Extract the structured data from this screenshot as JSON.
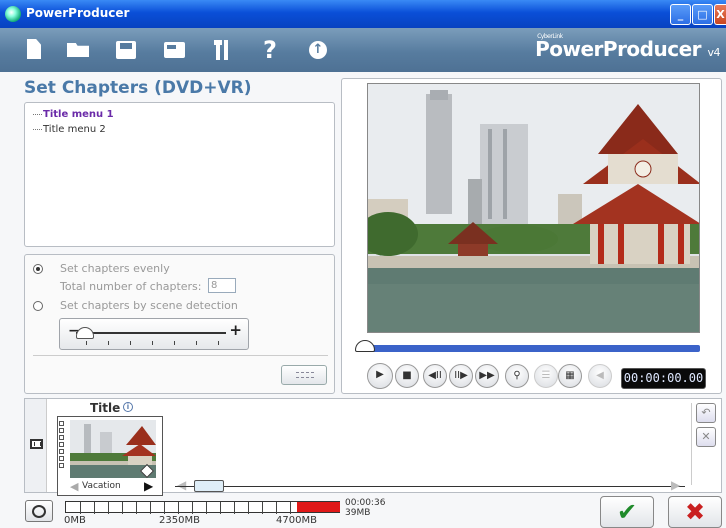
{
  "window": {
    "title": "PowerProducer",
    "minimize": "_",
    "maximize": "□",
    "close": "X"
  },
  "toolbar": {
    "icons": [
      "new-project-icon",
      "open-icon",
      "save-icon",
      "burn-icon",
      "tools-icon",
      "help-icon",
      "update-icon"
    ],
    "help_glyph": "?",
    "update_glyph": "↑",
    "brand_small": "CyberLink",
    "brand": "PowerProducer",
    "version": "v4"
  },
  "page": {
    "heading": "Set Chapters (DVD+VR)"
  },
  "menu_list": {
    "items": [
      "Title menu 1",
      "Title menu 2"
    ],
    "selected_index": 0
  },
  "chapter_options": {
    "evenly_label": "Set chapters evenly",
    "total_label": "Total number of chapters:",
    "total_value": "8",
    "scene_label": "Set chapters by scene detection",
    "selected": "evenly",
    "minus": "−",
    "plus": "+",
    "sensitivity_level": 0
  },
  "preview": {
    "timecode": "00:00:00.00",
    "playback_position": 0,
    "controls": [
      "play",
      "stop",
      "previous-frame",
      "next-frame",
      "fast-forward",
      "zoom",
      "chapter-set",
      "chapter-add",
      "volume"
    ],
    "glyphs": {
      "play": "▶",
      "stop": "■",
      "prev": "◀II",
      "next": "II▶",
      "ff": "▶▶",
      "zoom": "🔍",
      "mute": "◀"
    }
  },
  "timeline": {
    "title": "Title",
    "info": "i",
    "clip_name": "Vacation",
    "arrow_left": "◀",
    "arrow_right": "▶",
    "undo": "↶",
    "delete": "✕"
  },
  "capacity": {
    "labels": [
      "0MB",
      "2350MB",
      "4700MB"
    ],
    "duration": "00:00:36",
    "size": "39MB",
    "used_color": "#e01818"
  },
  "actions": {
    "ok": "✔",
    "cancel": "✖"
  },
  "colors": {
    "accent": "#4a79a8",
    "titlebar": "#0a4fd8",
    "toolbar": "#577c9f",
    "timecode_bg": "#0a0a0a"
  }
}
